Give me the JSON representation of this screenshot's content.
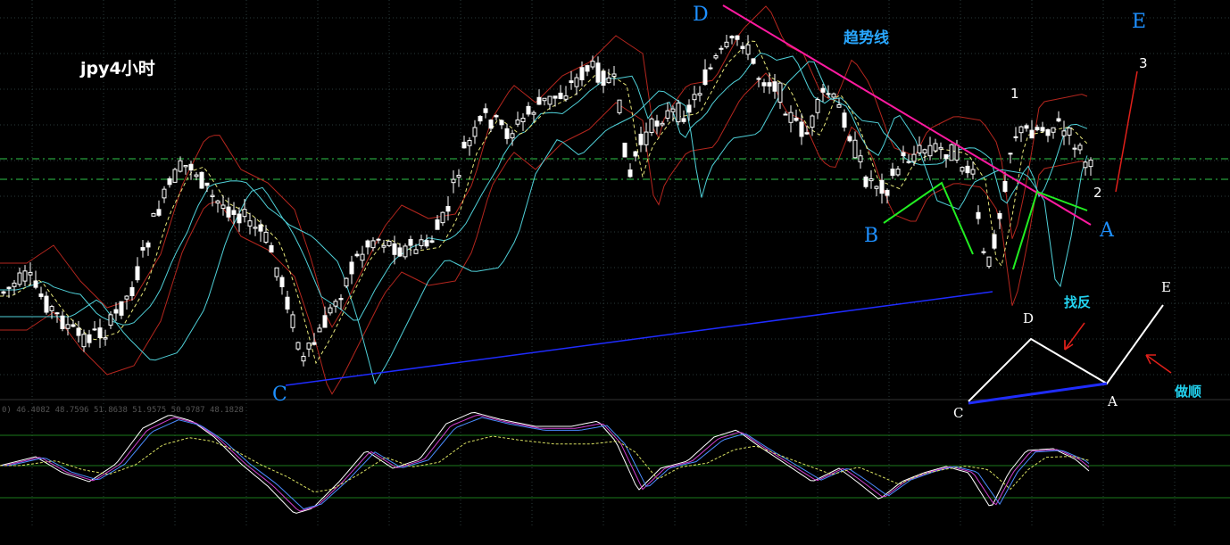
{
  "title": "jpy4小时",
  "annotations": {
    "trendline_label": "趋势线",
    "wave_labels": [
      "A",
      "B",
      "C",
      "D",
      "E"
    ],
    "count_labels": [
      "1",
      "2",
      "3"
    ],
    "schematic": {
      "labels": [
        "C",
        "D",
        "A",
        "E"
      ],
      "seek_reversal": "找反",
      "trade_with_trend": "做顺"
    }
  },
  "indicator_readout": "0) 46.4082 48.7596 51.8638 51.9575 50.9787 48.1828",
  "colors": {
    "background": "#000000",
    "grid": "#2a3a3a",
    "bull_candle": "#000000",
    "bear_candle": "#ffffff",
    "cyan_ma": "#4fd0d8",
    "red_band": "#b4261e",
    "yellow_ma": "#e6e67a",
    "trendline": "#ff1aa0",
    "support_line": "#1f2cff",
    "dashed_level": "#2fc64a",
    "green_marks": "#22ee22",
    "wave_label": "#1e90ff",
    "osc_white": "#ffffff",
    "osc_magenta": "#d040d0",
    "osc_blue": "#4a8cff",
    "osc_yellow": "#d8e060"
  },
  "chart_data": {
    "type": "candlestick",
    "symbol": "jpy",
    "timeframe": "4小时",
    "grid": true,
    "overlays": [
      "moving averages",
      "bollinger-style bands"
    ],
    "subchart": "stochastic oscillator"
  }
}
